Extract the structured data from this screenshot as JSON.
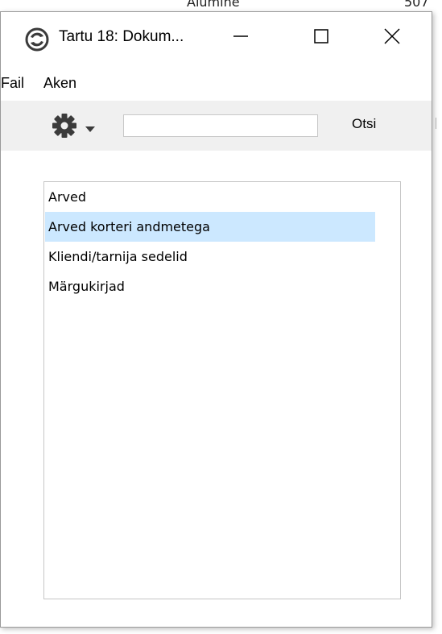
{
  "background": {
    "top_text_left": "Alumine",
    "top_text_right": "507"
  },
  "window": {
    "title": "Tartu 18: Dokum...",
    "icons": {
      "app": "app-logo-icon",
      "minimize": "minimize-icon",
      "maximize": "maximize-icon",
      "close": "close-icon"
    }
  },
  "menu": {
    "items": [
      "Fail",
      "Aken"
    ]
  },
  "toolbar": {
    "gear_icon": "gear-icon",
    "dropdown_icon": "caret-down-icon",
    "search_value": "",
    "search_button": "Otsi"
  },
  "list": {
    "items": [
      {
        "label": "Arved",
        "selected": false
      },
      {
        "label": "Arved korteri andmetega",
        "selected": true
      },
      {
        "label": "Kliendi/tarnija sedelid",
        "selected": false
      },
      {
        "label": "Märgukirjad",
        "selected": false
      }
    ]
  },
  "colors": {
    "selection": "#cce8ff",
    "window_bg": "#f0f0f0",
    "icon_dark": "#3b3b3b"
  }
}
